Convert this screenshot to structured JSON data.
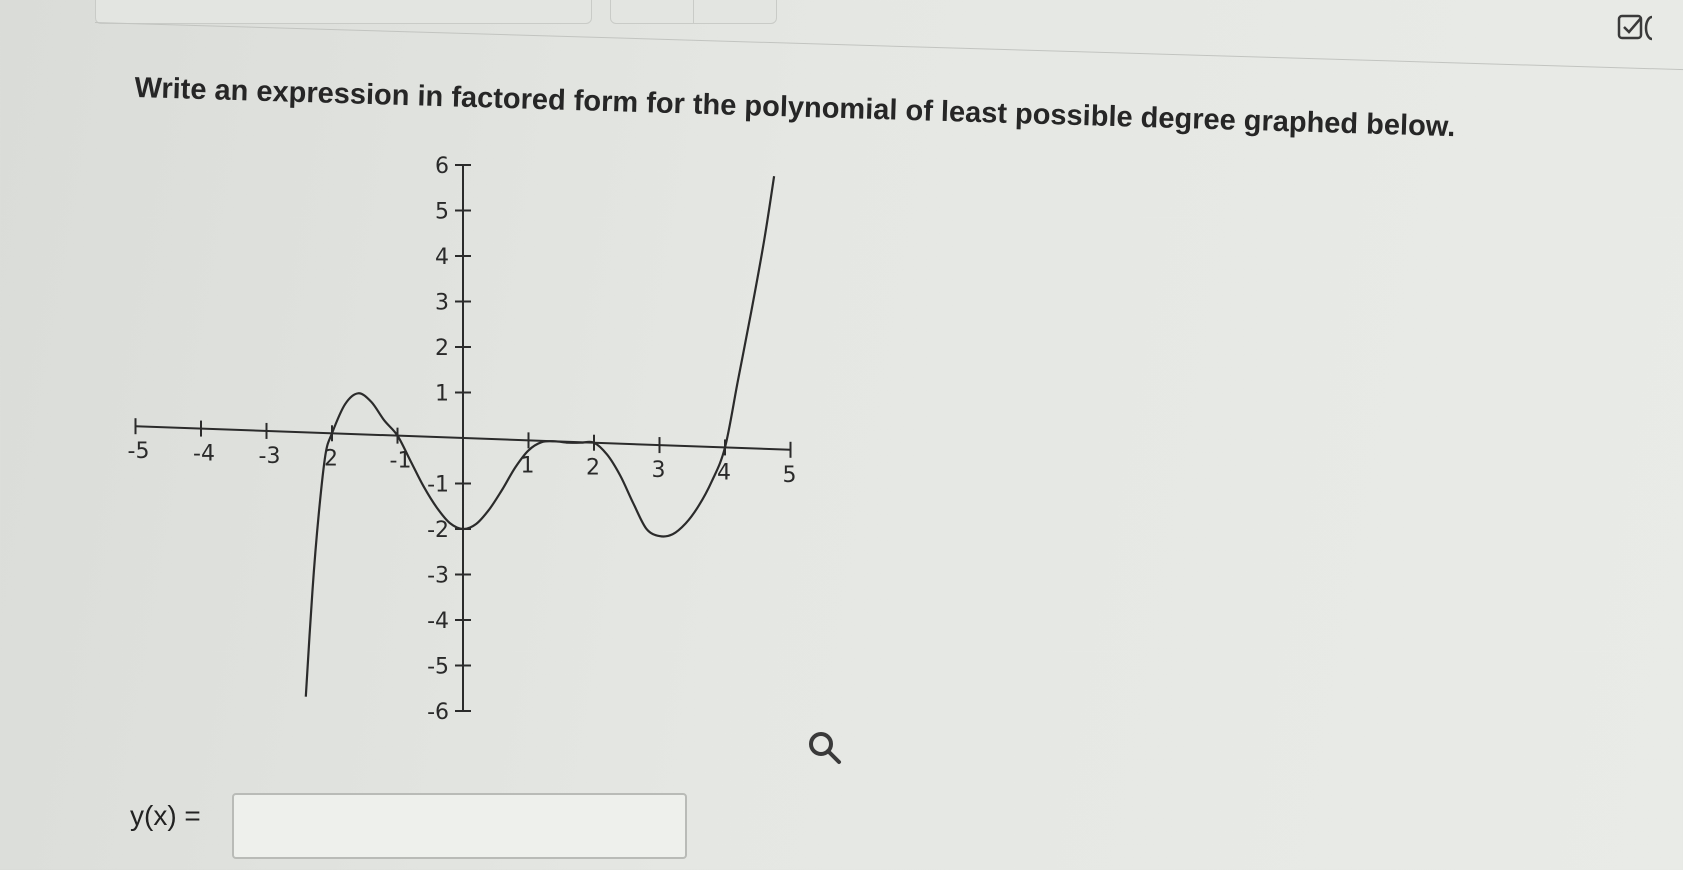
{
  "header": {
    "tabs": [
      {
        "label": ""
      },
      {
        "label": ""
      }
    ],
    "checkbox_icon": "checkbox-edit-icon"
  },
  "question": {
    "text": "Write an expression in factored form for the polynomial of least possible degree graphed below."
  },
  "graph": {
    "x_ticks": [
      "-5",
      "-4",
      "-3",
      "2",
      "-1",
      "1",
      "2",
      "3",
      "4",
      "5"
    ],
    "y_ticks": [
      "6",
      "5",
      "4",
      "3",
      "2",
      "1",
      "-1",
      "-2",
      "-3",
      "-4",
      "-5",
      "-6"
    ],
    "zoom_icon": "magnifier-icon"
  },
  "chart_data": {
    "type": "line",
    "title": "",
    "xlabel": "",
    "ylabel": "",
    "xlim": [
      -5,
      5
    ],
    "ylim": [
      -6,
      6
    ],
    "grid": false,
    "x_ticks": [
      -5,
      -4,
      -3,
      -2,
      -1,
      1,
      2,
      3,
      4,
      5
    ],
    "y_ticks": [
      -6,
      -5,
      -4,
      -3,
      -2,
      -1,
      1,
      2,
      3,
      4,
      5,
      6
    ],
    "series": [
      {
        "x": [
          -2.4,
          -2.3,
          -2.2,
          -2.1,
          -2.0,
          -1.8,
          -1.6,
          -1.4,
          -1.2,
          -1.0,
          -0.8,
          -0.6,
          -0.4,
          -0.2,
          0.0,
          0.2,
          0.4,
          0.6,
          0.8,
          1.0,
          1.2,
          1.4,
          1.6,
          1.8,
          2.0,
          2.2,
          2.4,
          2.6,
          2.8,
          3.0,
          3.2,
          3.4,
          3.6,
          3.8,
          4.0,
          4.2,
          4.4,
          4.6,
          4.75
        ],
        "y": [
          -5.81,
          -3.5,
          -1.75,
          -0.48,
          0.0,
          0.65,
          0.9,
          0.72,
          0.32,
          0.0,
          -0.55,
          -1.1,
          -1.55,
          -1.88,
          -2.0,
          -1.88,
          -1.55,
          -1.1,
          -0.6,
          -0.22,
          -0.03,
          0.0,
          -0.02,
          -0.01,
          0.0,
          -0.25,
          -0.7,
          -1.3,
          -1.85,
          -2.0,
          -1.95,
          -1.7,
          -1.3,
          -0.75,
          0.0,
          1.5,
          3.0,
          4.6,
          6.0
        ]
      }
    ]
  },
  "answer": {
    "label": "y(x) =",
    "value": "",
    "placeholder": ""
  }
}
